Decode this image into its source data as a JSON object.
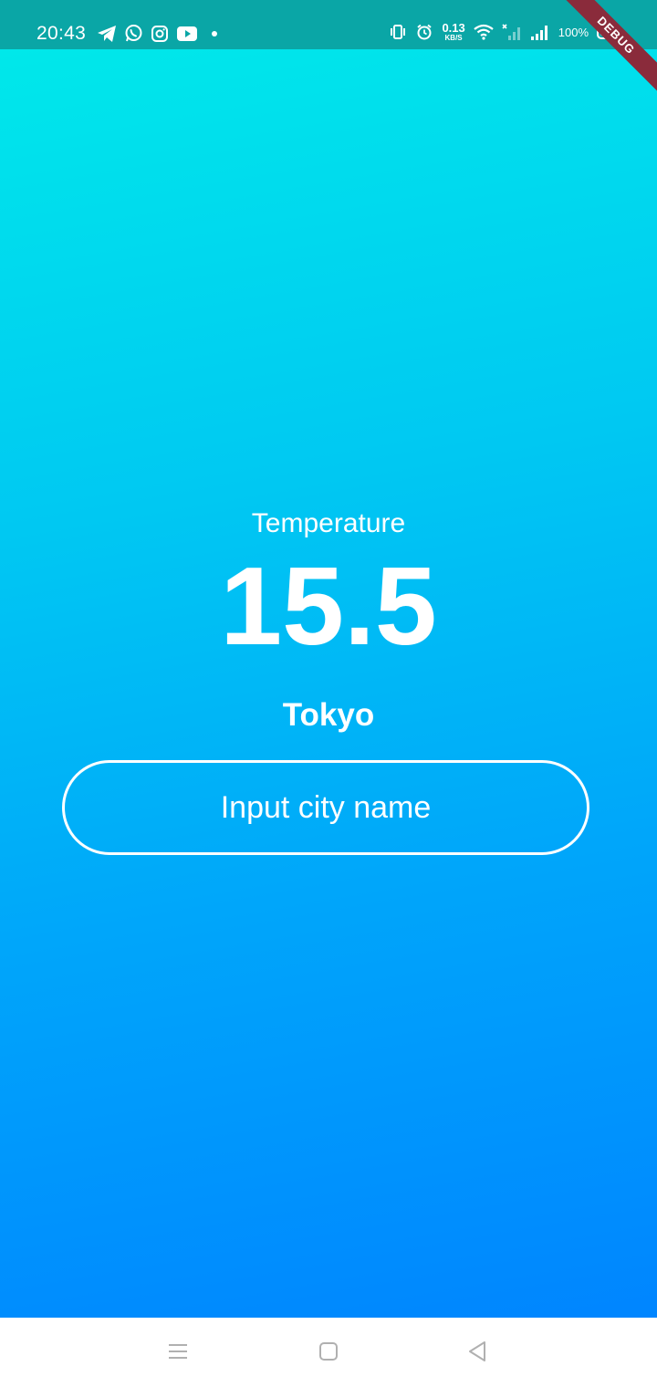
{
  "status_bar": {
    "time": "20:43",
    "left_icons": [
      "telegram-icon",
      "whatsapp-icon",
      "instagram-icon",
      "youtube-icon",
      "dot-icon"
    ],
    "net_speed_value": "0.13",
    "net_speed_unit": "KB/S",
    "battery_percent": "100%",
    "right_icons": [
      "vibrate-icon",
      "alarm-icon",
      "wifi-icon",
      "signal-no-sim-icon",
      "signal-icon",
      "battery-icon"
    ],
    "background_color": "#0aa6a6"
  },
  "debug_banner": "DEBUG",
  "weather": {
    "temperature_label": "Temperature",
    "temperature_value": "15.5",
    "city": "Tokyo"
  },
  "city_input": {
    "placeholder": "Input city name"
  },
  "nav_bar": {
    "buttons": [
      "menu-icon",
      "home-icon",
      "back-icon"
    ]
  },
  "colors": {
    "gradient_top": "#00e8ea",
    "gradient_bottom": "#0085ff",
    "text": "#ffffff"
  }
}
